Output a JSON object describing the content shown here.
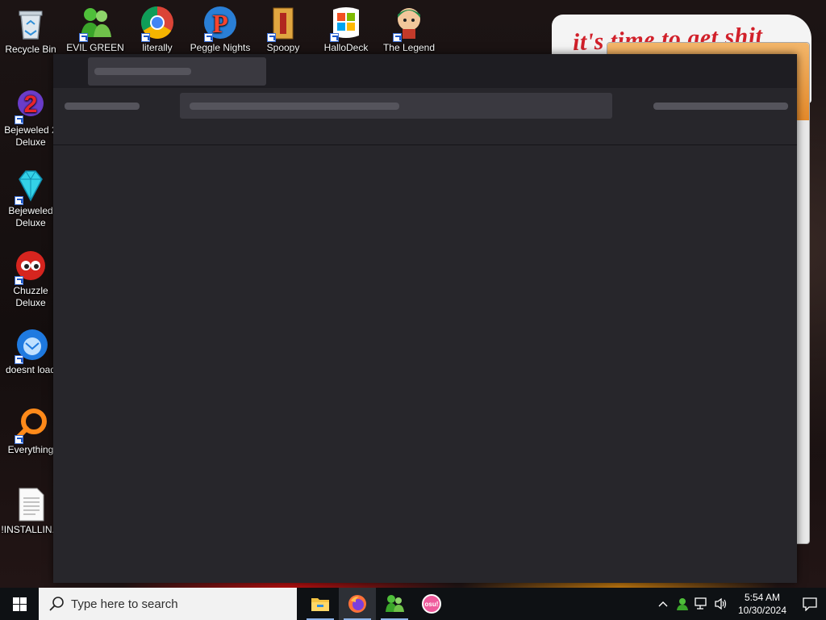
{
  "desktop": {
    "icons_left": [
      {
        "label": "Recycle Bin",
        "icon": "recycle-bin-icon"
      },
      {
        "label": "Bejeweled 2\nDeluxe",
        "icon": "bejeweled-2-icon"
      },
      {
        "label": "Bejeweled\nDeluxe",
        "icon": "bejeweled-gem-icon"
      },
      {
        "label": "Chuzzle\nDeluxe",
        "icon": "chuzzle-icon"
      },
      {
        "label": "doesnt load",
        "icon": "thunderbird-icon"
      },
      {
        "label": "Everything",
        "icon": "everything-search-icon"
      },
      {
        "label": "!INSTALLIN...",
        "icon": "text-document-icon"
      }
    ],
    "icons_top": [
      {
        "label": "EVIL GREEN",
        "icon": "msn-messenger-icon"
      },
      {
        "label": "literally",
        "icon": "chrome-icon"
      },
      {
        "label": "Peggle Nights",
        "icon": "peggle-icon"
      },
      {
        "label": "Spoopy",
        "icon": "spoopy-icon"
      },
      {
        "label": "HalloDeck",
        "icon": "microsoft-store-icon"
      },
      {
        "label": "The Legend",
        "icon": "legend-game-icon"
      }
    ],
    "poster_text": "it's time to get shit"
  },
  "taskbar": {
    "search_placeholder": "Type here to search",
    "apps": [
      {
        "name": "File Explorer",
        "icon": "file-explorer-icon"
      },
      {
        "name": "Firefox",
        "icon": "firefox-icon"
      },
      {
        "name": "Messenger",
        "icon": "msn-messenger-icon"
      },
      {
        "name": "osu!",
        "icon": "osu-icon"
      }
    ],
    "osu_label": "osu!",
    "time": "5:54 AM",
    "date": "10/30/2024"
  },
  "colors": {
    "window_bg": "#27262b",
    "titlebar_bg": "#1e1d22",
    "skeleton": "#55545c",
    "taskbar_bg": "#0e1114",
    "firefox_orange": "#ff7139",
    "osu_pink": "#ef5b9c"
  }
}
